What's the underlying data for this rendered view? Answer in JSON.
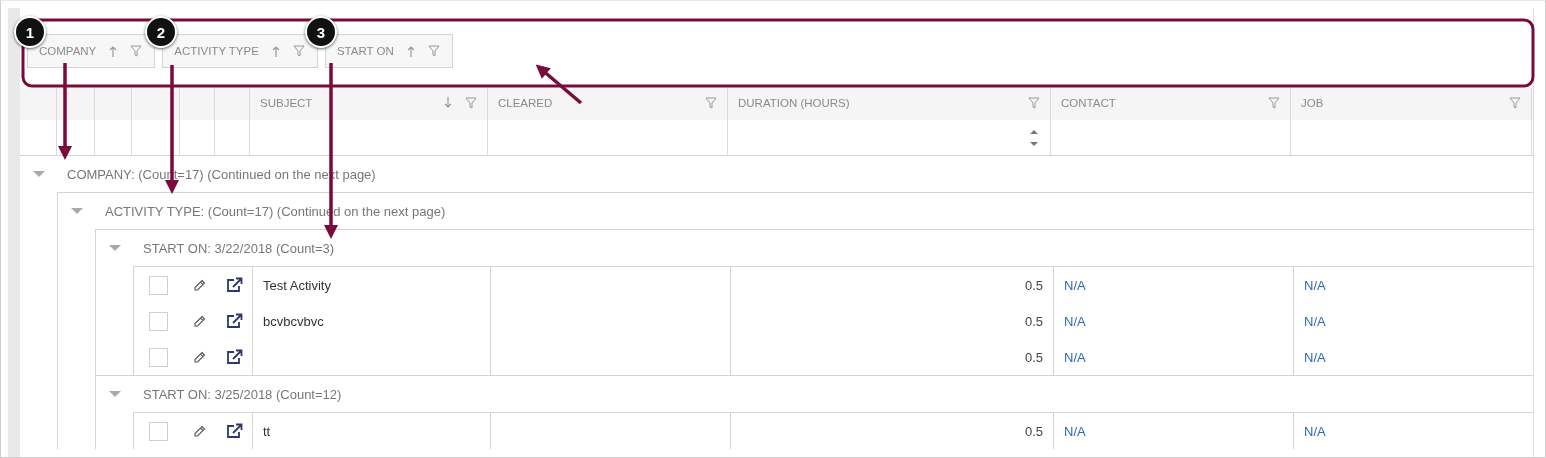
{
  "group_panel": [
    {
      "label": "COMPANY",
      "sorted": true,
      "descending": false
    },
    {
      "label": "ACTIVITY TYPE",
      "sorted": true,
      "descending": false
    },
    {
      "label": "START ON",
      "sorted": true,
      "descending": false
    }
  ],
  "columns": [
    {
      "label": "SUBJECT",
      "sorted": true,
      "descending": true,
      "kind": "text"
    },
    {
      "label": "CLEARED",
      "sorted": false,
      "kind": "text"
    },
    {
      "label": "DURATION (HOURS)",
      "sorted": false,
      "kind": "number"
    },
    {
      "label": "CONTACT",
      "sorted": false,
      "kind": "text"
    },
    {
      "label": "JOB",
      "sorted": false,
      "kind": "text"
    }
  ],
  "groups": [
    {
      "label": "COMPANY: (Count=17) (Continued on the next page)",
      "expanded": true,
      "children": [
        {
          "label": "ACTIVITY TYPE: (Count=17) (Continued on the next page)",
          "expanded": true,
          "children": [
            {
              "label": "START ON: 3/22/2018 (Count=3)",
              "expanded": true,
              "rows": [
                {
                  "checked": false,
                  "subject": "Test Activity",
                  "duration": "0.5",
                  "contact": "N/A",
                  "job": "N/A"
                },
                {
                  "checked": false,
                  "subject": "bcvbcvbvc",
                  "duration": "0.5",
                  "contact": "N/A",
                  "job": "N/A"
                },
                {
                  "checked": false,
                  "duration": "0.5",
                  "contact": "N/A",
                  "job": "N/A"
                }
              ]
            },
            {
              "label": "START ON: 3/25/2018 (Count=12)",
              "expanded": true,
              "rows": [
                {
                  "checked": false,
                  "subject": "tt",
                  "duration": "0.5",
                  "contact": "N/A",
                  "job": "N/A"
                }
              ]
            }
          ]
        }
      ]
    }
  ],
  "callouts": [
    "1",
    "2",
    "3"
  ]
}
